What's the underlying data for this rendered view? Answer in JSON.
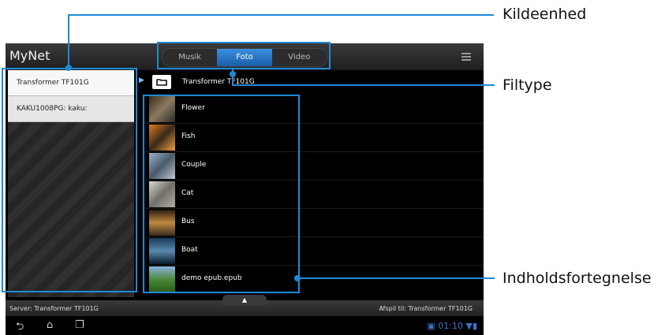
{
  "app": {
    "title": "MyNet"
  },
  "tabs": [
    {
      "label": "Musik",
      "active": false
    },
    {
      "label": "Foto",
      "active": true
    },
    {
      "label": "Video",
      "active": false
    }
  ],
  "sidebar": {
    "items": [
      {
        "label": "Transformer TF101G",
        "selected": true
      },
      {
        "label": "KAKU1008PG: kaku:",
        "selected": false
      }
    ]
  },
  "breadcrumb": {
    "label": "Transformer TF101G",
    "icon": "folder-back-icon"
  },
  "content": {
    "items": [
      {
        "label": "Flower",
        "thumb_color": "#5a4a3a"
      },
      {
        "label": "Fish",
        "thumb_color": "#c05a20"
      },
      {
        "label": "Couple",
        "thumb_color": "#7a8aa0"
      },
      {
        "label": "Cat",
        "thumb_color": "#a8a8a0"
      },
      {
        "label": "Bus",
        "thumb_color": "#6a5030"
      },
      {
        "label": "Boat",
        "thumb_color": "#2a5a7a"
      },
      {
        "label": "demo epub.epub",
        "thumb_color": "#4a8a4a"
      }
    ]
  },
  "footer": {
    "server": "Server: Transformer TF101G",
    "play_to": "Afspil til: Transformer TF101G"
  },
  "statusbar": {
    "time": "01:10"
  },
  "callouts": {
    "source": "Kildeenhed",
    "filetype": "Filtype",
    "index": "Indholdsfortegnelse"
  },
  "colors": {
    "accent": "#1f8ad6",
    "active_tab": "#2a78c8"
  }
}
